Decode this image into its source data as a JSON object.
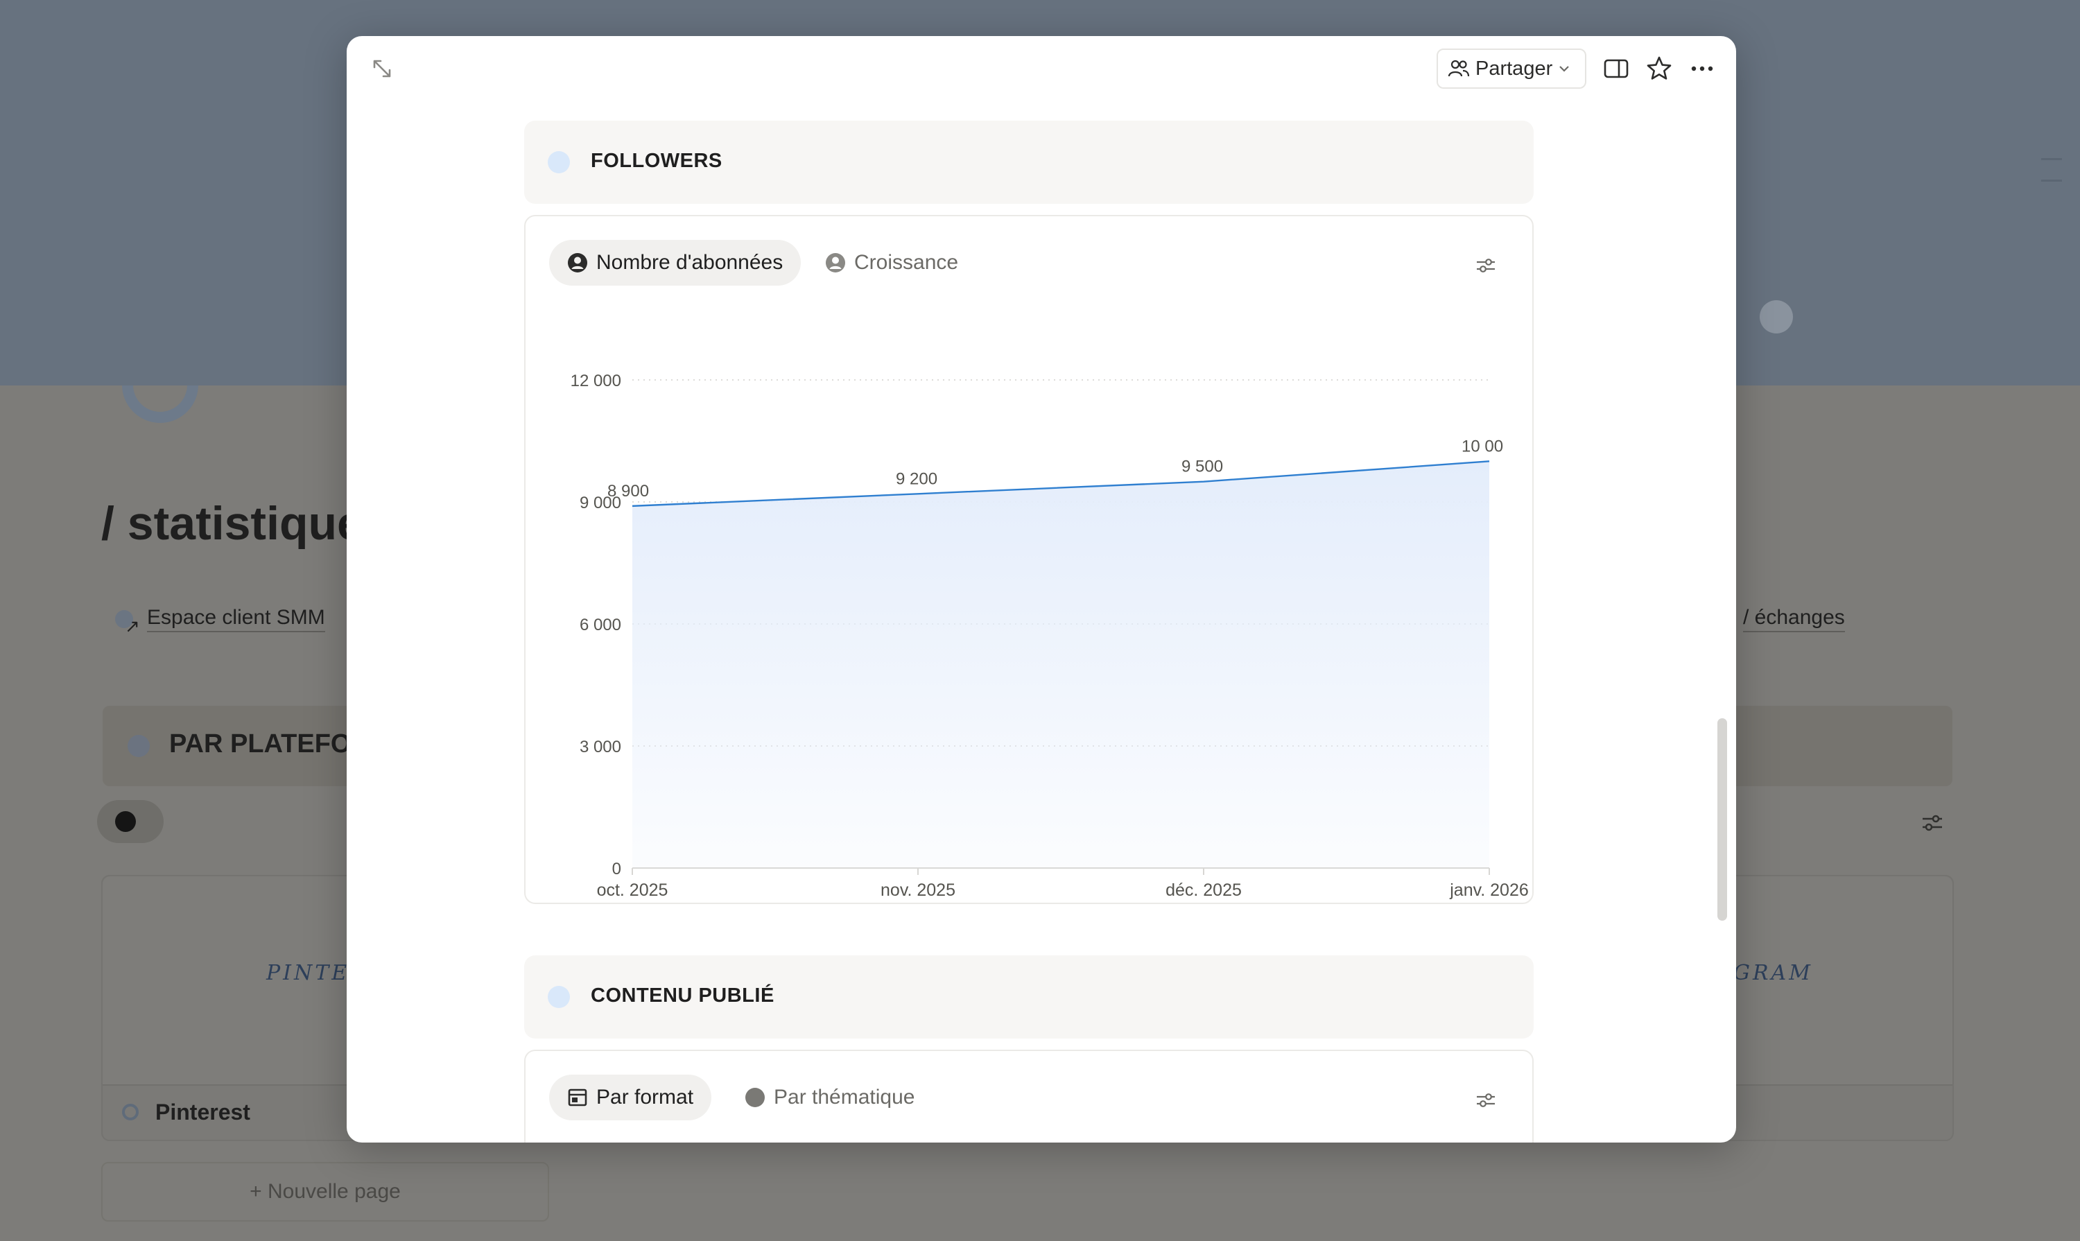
{
  "background": {
    "page_title": "/ statistique",
    "link_left": "Espace client SMM",
    "link_right": "/ échanges",
    "section_title": "PAR PLATEFOR",
    "card_left_script": "PINTER",
    "card_right_script": "GRAM",
    "card_left_label": "Pinterest",
    "new_page": "+  Nouvelle page"
  },
  "toolbar": {
    "share_label": "Partager"
  },
  "followers_section": {
    "title": "FOLLOWERS",
    "tabs": [
      {
        "label": "Nombre d'abonnées",
        "active": true
      },
      {
        "label": "Croissance",
        "active": false
      }
    ]
  },
  "content_section": {
    "title": "CONTENU PUBLIÉ",
    "tabs": [
      {
        "label": "Par format",
        "active": true
      },
      {
        "label": "Par thématique",
        "active": false
      }
    ]
  },
  "colors": {
    "line": "#2f7fd0",
    "fill": "#e7effb",
    "section_dot": "#d9e8fa"
  },
  "chart_data": {
    "type": "area",
    "categories": [
      "oct. 2025",
      "nov. 2025",
      "déc. 2025",
      "janv. 2026"
    ],
    "values": [
      8900,
      9200,
      9500,
      10000
    ],
    "data_labels": [
      "8 900",
      "9 200",
      "9 500",
      "10 00"
    ],
    "ylim": [
      0,
      12000
    ],
    "yticks": [
      0,
      3000,
      6000,
      9000,
      12000
    ],
    "ytick_labels": [
      "0",
      "3 000",
      "6 000",
      "9 000",
      "12 000"
    ],
    "grid": true,
    "legend": "none"
  }
}
